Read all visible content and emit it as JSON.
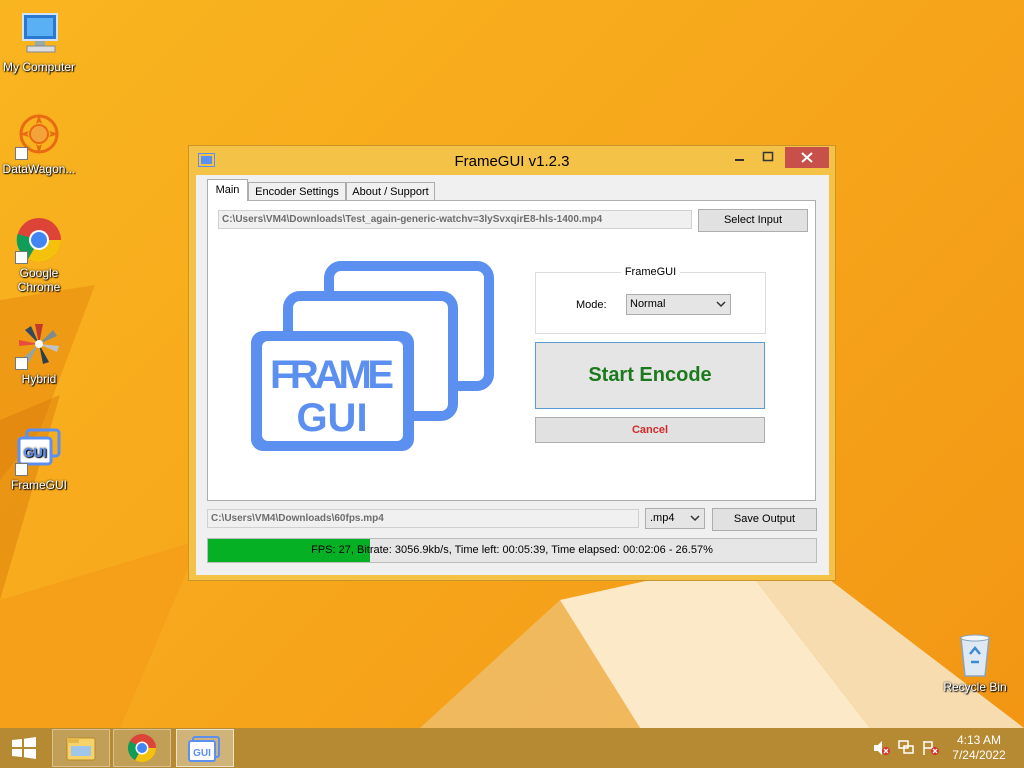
{
  "desktop": {
    "icons": [
      {
        "label": "My Computer",
        "icon": "computer-icon"
      },
      {
        "label": "DataWagon...",
        "icon": "datawagon-icon"
      },
      {
        "label": "Google Chrome",
        "icon": "chrome-icon"
      },
      {
        "label": "Hybrid",
        "icon": "hybrid-icon"
      },
      {
        "label": "FrameGUI",
        "icon": "framegui-icon"
      },
      {
        "label": "Recycle Bin",
        "icon": "recycle-bin-icon"
      }
    ]
  },
  "window": {
    "title": "FrameGUI v1.2.3",
    "tabs": [
      {
        "label": "Main",
        "active": true
      },
      {
        "label": "Encoder Settings",
        "active": false
      },
      {
        "label": "About / Support",
        "active": false
      }
    ],
    "main": {
      "input_path": "C:\\Users\\VM4\\Downloads\\Test_again-generic-watchv=3lySvxqirE8-hls-1400.mp4",
      "select_input_label": "Select Input",
      "logo": {
        "line1": "FRAME",
        "line2": "GUI",
        "color": "#5b8ff0"
      },
      "group_title": "FrameGUI",
      "mode_label": "Mode:",
      "mode_value": "Normal",
      "start_label": "Start Encode",
      "cancel_label": "Cancel"
    },
    "output_path": "C:\\Users\\VM4\\Downloads\\60fps.mp4",
    "extension": ".mp4",
    "save_output_label": "Save Output",
    "progress": {
      "fraction": 0.2657,
      "text": "FPS: 27, Bitrate: 3056.9kb/s, Time left: 00:05:39, Time elapsed: 00:02:06 - 26.57%"
    }
  },
  "taskbar": {
    "items": [
      "start-icon",
      "file-explorer-icon",
      "chrome-icon",
      "framegui-icon"
    ],
    "time": "4:13 AM",
    "date": "7/24/2022"
  },
  "colors": {
    "accent": "#5b8ff0",
    "start_text": "#1c7a1c",
    "cancel_text": "#d22a2a",
    "progress": "#06b025",
    "close_button": "#c7504a"
  }
}
